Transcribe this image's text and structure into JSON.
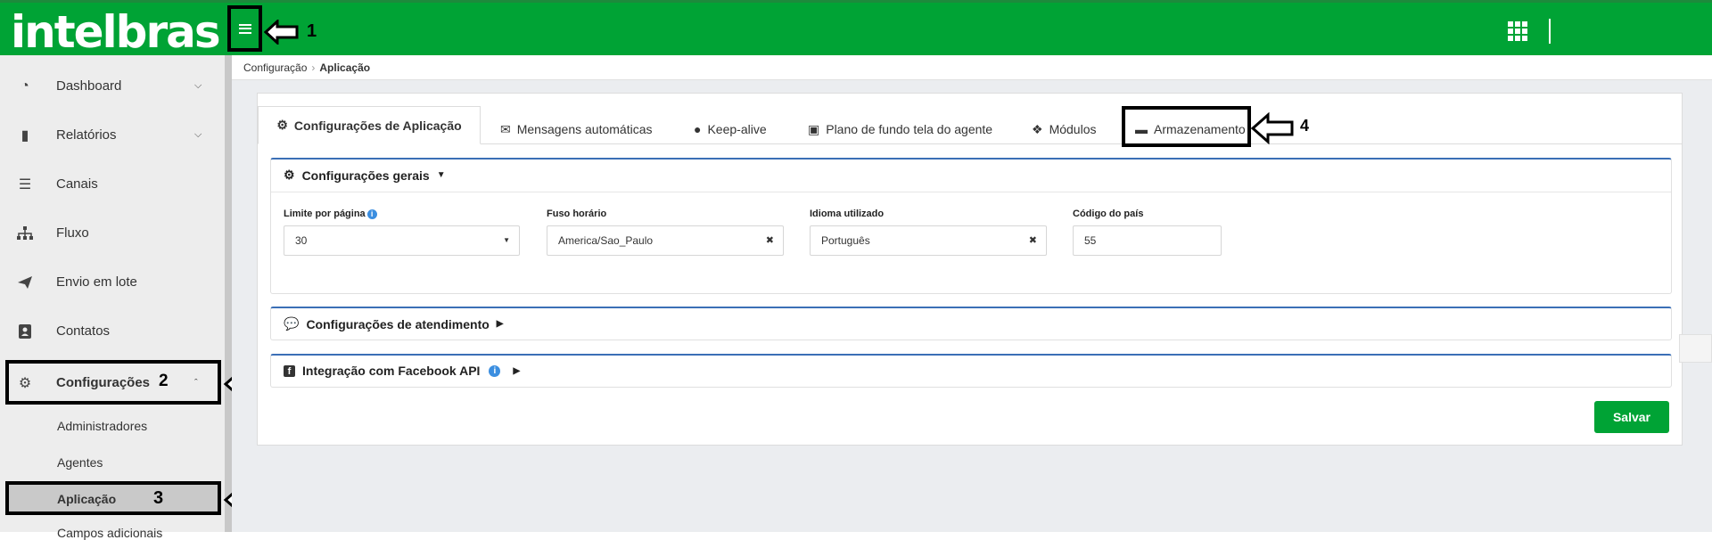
{
  "brand": {
    "logo_text": "intelbras",
    "primary_color": "#00a335"
  },
  "annotations": {
    "n1": "1",
    "n2": "2",
    "n3": "3",
    "n4": "4"
  },
  "sidebar": {
    "items": [
      {
        "label": "Dashboard",
        "icon": "gauge-icon"
      },
      {
        "label": "Relatórios",
        "icon": "book-icon"
      },
      {
        "label": "Canais",
        "icon": "list-icon"
      },
      {
        "label": "Fluxo",
        "icon": "sitemap-icon"
      },
      {
        "label": "Envio em lote",
        "icon": "paper-plane-icon"
      },
      {
        "label": "Contatos",
        "icon": "address-book-icon"
      },
      {
        "label": "Configurações",
        "icon": "cogs-icon"
      }
    ],
    "sub_items": [
      "Administradores",
      "Agentes",
      "Aplicação",
      "Campos adicionais"
    ]
  },
  "breadcrumb": {
    "parent": "Configuração",
    "current": "Aplicação"
  },
  "tabs": [
    {
      "label": "Configurações de Aplicação",
      "icon": "gear-icon"
    },
    {
      "label": "Mensagens automáticas",
      "icon": "envelope-icon"
    },
    {
      "label": "Keep-alive",
      "icon": "lightbulb-icon"
    },
    {
      "label": "Plano de fundo tela do agente",
      "icon": "image-icon"
    },
    {
      "label": "Módulos",
      "icon": "cubes-icon"
    },
    {
      "label": "Armazenamento",
      "icon": "hdd-icon"
    }
  ],
  "panels": {
    "general": {
      "title": "Configurações gerais",
      "fields": {
        "limit": {
          "label": "Limite por página",
          "value": "30"
        },
        "timezone": {
          "label": "Fuso horário",
          "value": "America/Sao_Paulo"
        },
        "language": {
          "label": "Idioma utilizado",
          "value": "Português"
        },
        "country": {
          "label": "Código do país",
          "value": "55"
        }
      }
    },
    "service": {
      "title": "Configurações de atendimento"
    },
    "facebook": {
      "title": "Integração com Facebook API"
    }
  },
  "actions": {
    "save": "Salvar"
  }
}
